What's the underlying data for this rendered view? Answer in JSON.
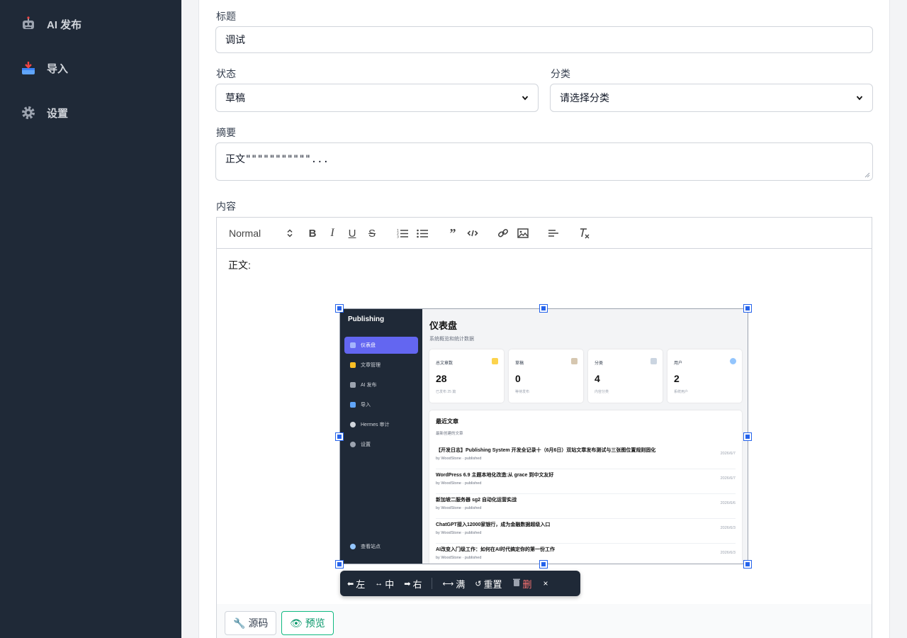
{
  "sidebar": {
    "items": [
      {
        "label": "AI 发布",
        "icon": "robot-icon"
      },
      {
        "label": "导入",
        "icon": "inbox-tray-icon"
      },
      {
        "label": "设置",
        "icon": "gear-icon"
      }
    ]
  },
  "form": {
    "title_label": "标题",
    "title_value": "调试",
    "status_label": "状态",
    "status_value": "草稿",
    "category_label": "分类",
    "category_value": "请选择分类",
    "summary_label": "摘要",
    "summary_value": "正文\"\"\"\"\"\"\"\"\"\"\"...",
    "content_label": "内容"
  },
  "editor": {
    "header_select": "Normal",
    "body_text": "正文:"
  },
  "embedded_screenshot": {
    "brand": "Publishing",
    "nav": [
      "仪表盘",
      "文章管理",
      "AI 发布",
      "导入",
      "Hermes 审计",
      "设置"
    ],
    "footer_nav": "查看站点",
    "page_title": "仪表盘",
    "page_subtitle": "系统概览和统计数据",
    "cards": [
      {
        "title": "总文章数",
        "value": "28",
        "note": "已发布 25 篇"
      },
      {
        "title": "草稿",
        "value": "0",
        "note": "等待发布"
      },
      {
        "title": "分类",
        "value": "4",
        "note": "内容分类"
      },
      {
        "title": "用户",
        "value": "2",
        "note": "系统用户"
      }
    ],
    "recent_title": "最近文章",
    "recent_subtitle": "最新创建的文章",
    "articles": [
      {
        "title": "【开发日志】Publishing System 开发全记录十（6月6日）双站文章发布测试与三张图位置规则固化",
        "meta": "by WoodStone · published",
        "date": "2026/6/7"
      },
      {
        "title": "WordPress 6.9 主题本地化改造:从 grace 到中文友好",
        "meta": "by WoodStone · published",
        "date": "2026/6/7"
      },
      {
        "title": "新加坡二服务器 sg2 自动化运营实战",
        "meta": "by WoodStone · published",
        "date": "2026/6/6"
      },
      {
        "title": "ChatGPT接入12000家银行，成为金融数据超级入口",
        "meta": "by WoodStone · published",
        "date": "2026/6/3"
      },
      {
        "title": "AI改变入门级工作：如何在AI时代搞定你的第一份工作",
        "meta": "by WoodStone · published",
        "date": "2026/6/3"
      }
    ]
  },
  "image_toolbar": {
    "left": "左",
    "center": "中",
    "right": "右",
    "full": "满",
    "reset": "重置",
    "delete": "删",
    "close": "×"
  },
  "footer": {
    "source_label": "源码",
    "preview_label": "预览"
  },
  "colors": {
    "sidebar_bg": "#1f2937",
    "accent": "#6366f1",
    "handle": "#2563eb",
    "preview_green": "#10b981"
  }
}
